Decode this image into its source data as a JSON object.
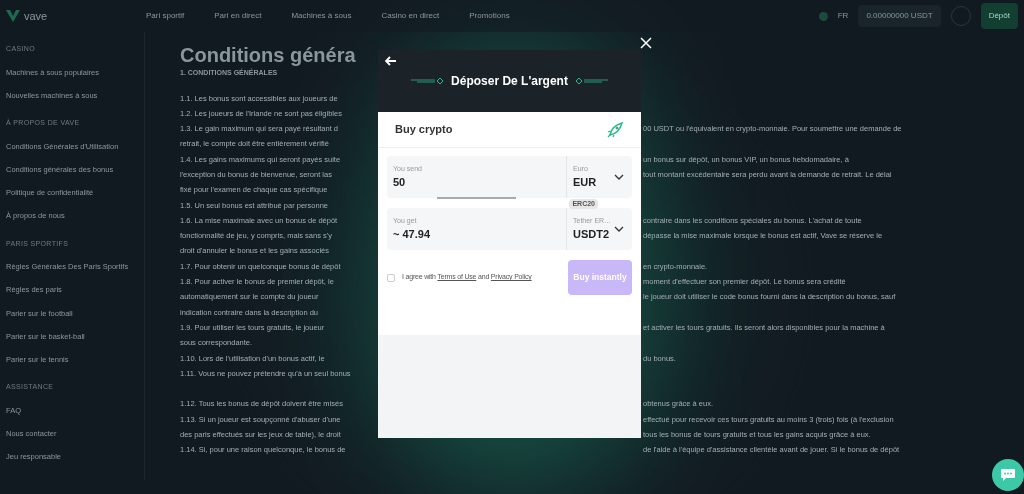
{
  "nav": {
    "logo": "vave",
    "links": [
      "Pari sportif",
      "Pari en direct",
      "Machines à sous",
      "Casino en direct",
      "Promotions"
    ],
    "language": "FR",
    "balance": "0.00000000 USDT",
    "deposit": "Dépôt"
  },
  "sidebar": {
    "sections": [
      {
        "title": "CASINO",
        "items": [
          "Machines à sous populaires",
          "Nouvelles machines à sous"
        ]
      },
      {
        "title": "À PROPOS DE VAVE",
        "items": [
          "Conditions Générales d'Utilisation",
          "Conditions générales des bonus",
          "Politique de confidentialité",
          "À propos de nous"
        ]
      },
      {
        "title": "PARIS SPORTIFS",
        "items": [
          "Règles Générales Des Paris Sportifs",
          "Règles des paris",
          "Parier sur le football",
          "Parier sur le basket-ball",
          "Parier sur le tennis"
        ]
      },
      {
        "title": "ASSISTANCE",
        "items": [
          "FAQ",
          "Nous contacter",
          "Jeu responsable"
        ]
      }
    ]
  },
  "content": {
    "title": "Conditions généra",
    "heading": "1. CONDITIONS GÉNÉRALES",
    "paragraphs": [
      [
        {
          "left": "1.1. Les bonus sont accessibles aux joueurs de"
        },
        {
          "left": "1.2. Les joueurs de l'Irlande ne sont pas éligibles"
        },
        {
          "left": "1.3. Le gain maximum qui sera payé résultant d",
          "right": "00 USDT ou l'équivalent en crypto-monnaie. Pour soumettre une demande de"
        },
        {
          "left": "retrait, le compte doit être entièrement vérifié"
        },
        {
          "left": "1.4. Les gains maximums qui seront payés suite",
          "right": "un bonus sur dépôt, un bonus VIP, un bonus hebdomadaire, à"
        },
        {
          "left": "l'exception du bonus de bienvenue, seront las",
          "right": "tout montant excédentaire sera perdu avant la demande de retrait. Le délai"
        },
        {
          "left": "fixé pour l'examen de chaque cas spécifique"
        },
        {
          "left": "1.5. Un seul bonus est attribué par personne"
        },
        {
          "left": "1.6. La mise maximale avec un bonus de dépôt",
          "right": "contraire dans les conditions spéciales du bonus. L'achat de toute"
        },
        {
          "left": "fonctionnalité de jeu, y compris, mais sans s'y",
          "right": "dépasse la mise maximale lorsque le bonus est actif, Vave se réserve le"
        },
        {
          "left": "droit d'annuler le bonus et les gains associés"
        },
        {
          "left": "1.7. Pour obtenir un quelconque bonus de dépôt",
          "right": "en crypto-monnaie."
        },
        {
          "left": "1.8. Pour activer le bonus de premier dépôt, le",
          "right": "moment d'effectuer son premier dépôt. Le bonus sera crédité"
        },
        {
          "left": "automatiquement sur le compte du joueur",
          "right": "le joueur doit utiliser le code bonus fourni dans la description du bonus, sauf"
        },
        {
          "left": "indication contraire dans la description du"
        },
        {
          "left": "1.9. Pour utiliser les tours gratuits, le joueur",
          "right": "et activer les tours gratuits. Ils seront alors disponibles pour la machine à"
        },
        {
          "left": "sous correspondante."
        },
        {
          "left": "1.10. Lors de l'utilisation d'un bonus actif, le",
          "right": "du bonus."
        },
        {
          "left": "1.11. Vous ne pouvez prétendre qu'à un seul bonus"
        }
      ],
      [
        {
          "left": "1.12. Tous les bonus de dépôt doivent être misés",
          "right": "obtenus grâce à eux."
        },
        {
          "left": "1.13. Si un joueur est soupçonné d'abuser d'une",
          "right": "effectué pour recevoir ces tours gratuits au moins 3 (trois) fois (à l'exclusion"
        },
        {
          "left": "des paris effectués sur les jeux de table), le droit",
          "right": "tous les bonus de tours gratuits et tous les gains acquis grâce à eux."
        },
        {
          "left": "1.14. Si, pour une raison quelconque, le bonus de",
          "right": "de l'aide à l'équipe d'assistance clientèle avant de jouer. Si le bonus de dépôt"
        }
      ]
    ]
  },
  "modal": {
    "title": "Déposer De L'argent",
    "subtitle": "Buy crypto",
    "send": {
      "label": "You send",
      "value": "50",
      "currency_label": "Euro",
      "currency": "EUR"
    },
    "get": {
      "label": "You get",
      "value": "~ 47.94",
      "badge": "ERC20",
      "currency_label": "Tether ER…",
      "currency": "USDT2"
    },
    "agree": {
      "checked": false,
      "prefix": "I agree with",
      "terms": "Terms of Use",
      "middle": "and",
      "privacy": "Privacy Policy"
    },
    "buy": {
      "label": "Buy instantly",
      "disabled": true
    }
  }
}
